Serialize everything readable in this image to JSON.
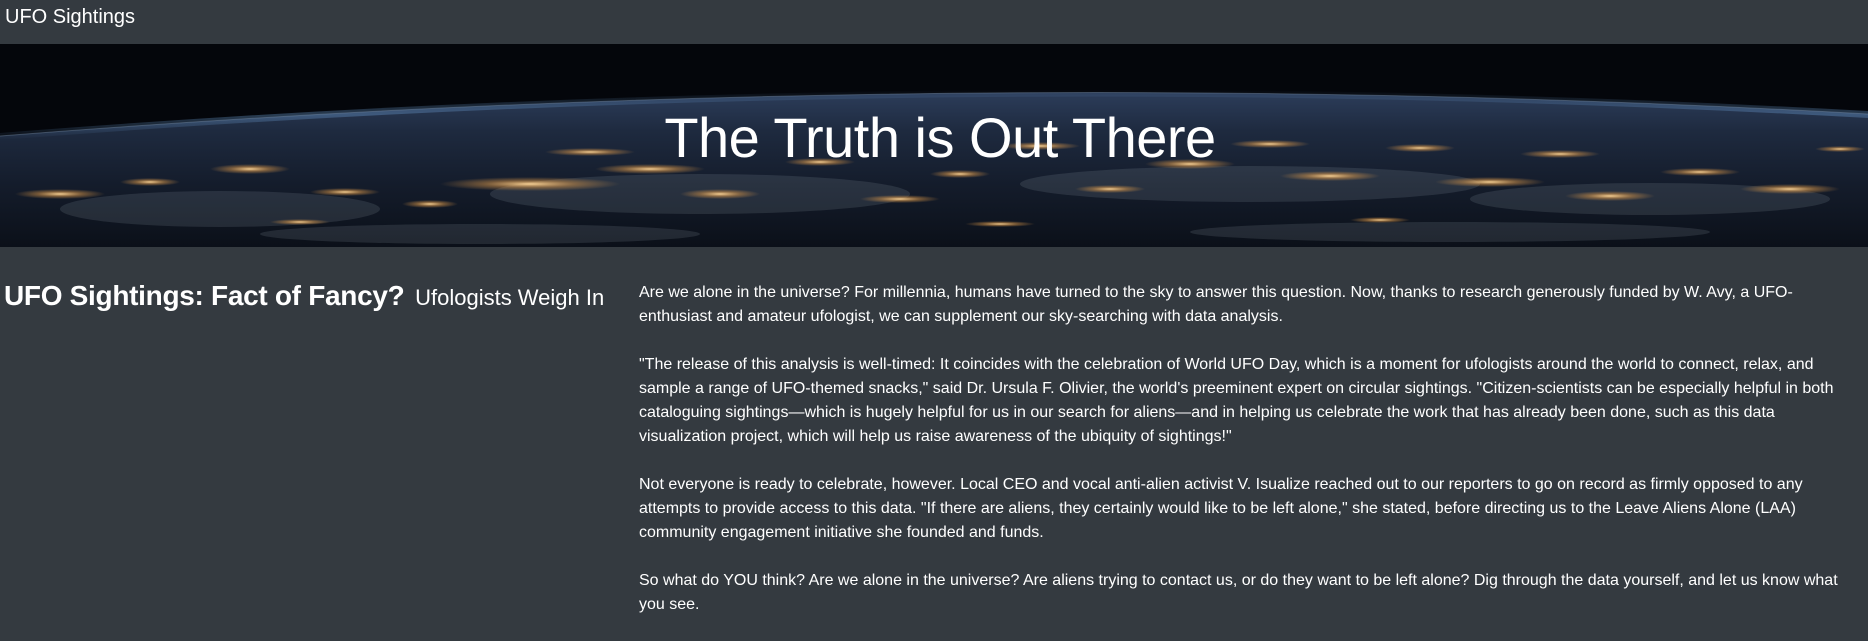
{
  "navbar": {
    "brand": "UFO Sightings"
  },
  "hero": {
    "title": "The Truth is Out There"
  },
  "headline": {
    "main": "UFO Sightings: Fact of Fancy?",
    "sub": "Ufologists Weigh In"
  },
  "article": {
    "paragraphs": [
      "Are we alone in the universe? For millennia, humans have turned to the sky to answer this question. Now, thanks to research generously funded by W. Avy, a UFO-enthusiast and amateur ufologist, we can supplement our sky-searching with data analysis.",
      "\"The release of this analysis is well-timed: It coincides with the celebration of World UFO Day, which is a moment for ufologists around the world to connect, relax, and sample a range of UFO-themed snacks,\" said Dr. Ursula F. Olivier, the world's preeminent expert on circular sightings. \"Citizen-scientists can be especially helpful in both cataloguing sightings—which is hugely helpful for us in our search for aliens—and in helping us celebrate the work that has already been done, such as this data visualization project, which will help us raise awareness of the ubiquity of sightings!\"",
      "Not everyone is ready to celebrate, however. Local CEO and vocal anti-alien activist V. Isualize reached out to our reporters to go on record as firmly opposed to any attempts to provide access to this data. \"If there are aliens, they certainly would like to be left alone,\" she stated, before directing us to the Leave Aliens Alone (LAA) community engagement initiative she founded and funds.",
      "So what do YOU think? Are we alone in the universe? Are aliens trying to contact us, or do they want to be left alone? Dig through the data yourself, and let us know what you see."
    ]
  },
  "colors": {
    "background": "#343a40",
    "text": "#ffffff",
    "hero_sky": "#04060b",
    "city_lights": "#f4c27a"
  }
}
